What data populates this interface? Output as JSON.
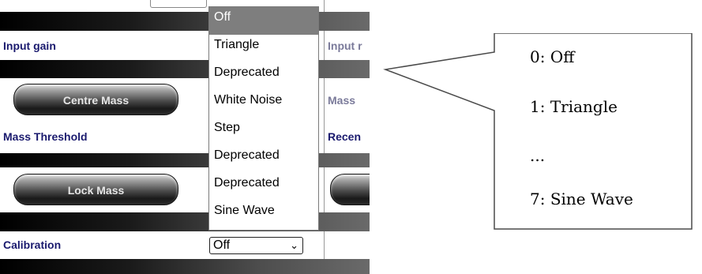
{
  "panel": {
    "labels": {
      "input_gain": "Input gain",
      "input_right": "Input r",
      "mass_right": "Mass",
      "mass_threshold": "Mass Threshold",
      "recen_right": "Recen",
      "calibration": "Calibration"
    },
    "buttons": {
      "centre_mass": "Centre Mass",
      "lock_mass": "Lock Mass"
    },
    "calibration_select": {
      "value": "Off",
      "chevron": "⌄"
    }
  },
  "dropdown": {
    "options": [
      "Off",
      "Triangle",
      "Deprecated",
      "White Noise",
      "Step",
      "Deprecated",
      "Deprecated",
      "Sine Wave"
    ],
    "selected": "Off"
  },
  "callout": {
    "lines": [
      "0: Off",
      "1: Triangle",
      "...",
      "7: Sine Wave"
    ]
  },
  "colors": {
    "label_text": "#1a1a6e",
    "dropdown_selected_bg": "#7e7e7e",
    "callout_border": "#4a4a4a"
  }
}
